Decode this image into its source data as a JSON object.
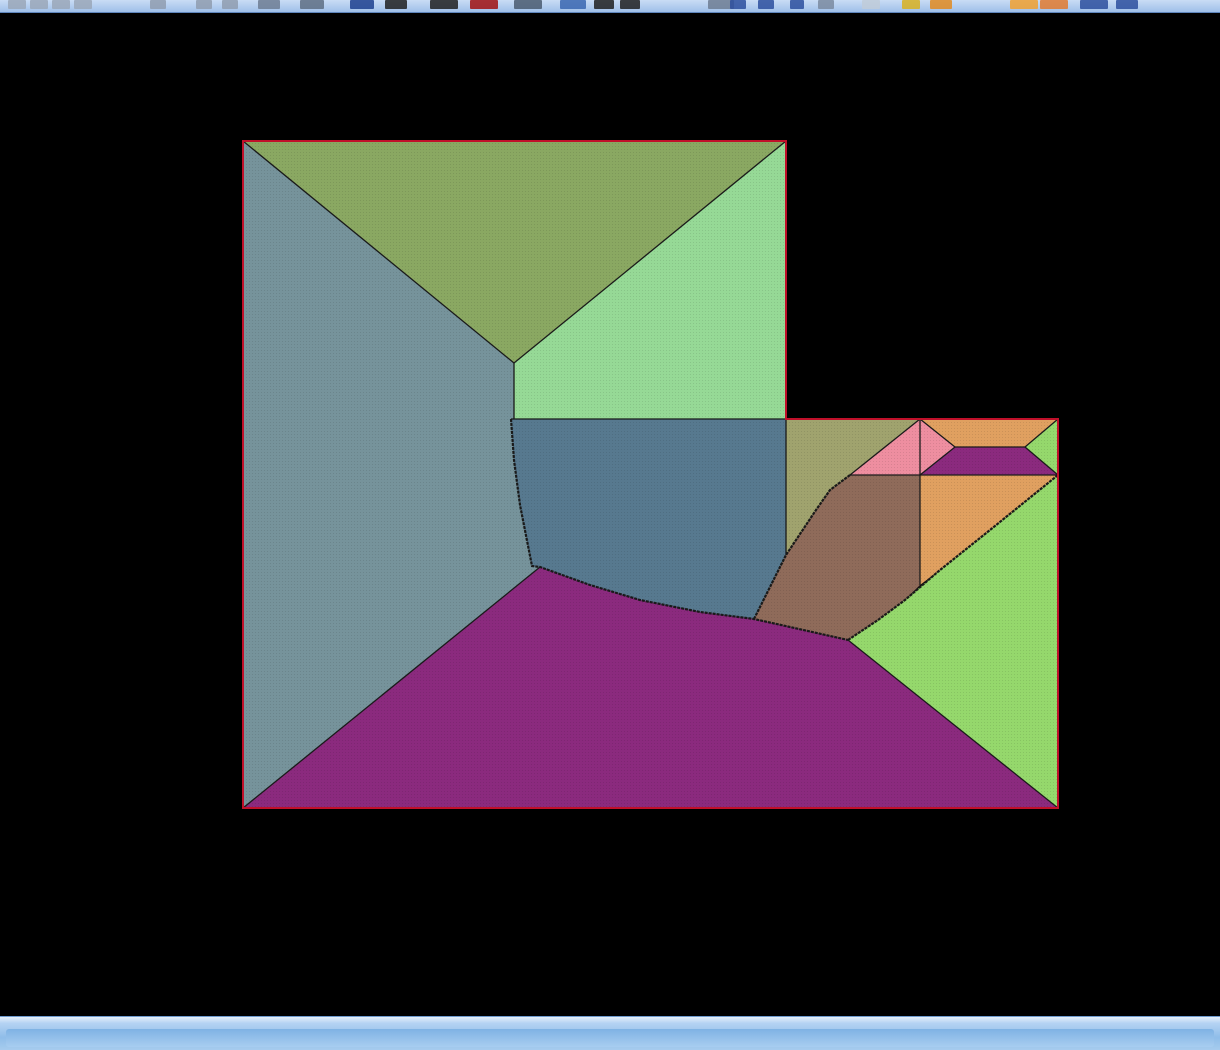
{
  "window": {
    "background": "#000000",
    "toolbar_color": "#a9c6ee",
    "statusbar_color": "#9cc4ee"
  },
  "toolbar": {
    "items": [
      {
        "icon": "pencil-icon",
        "color": "#9aa7b8"
      },
      {
        "icon": "pencil-icon",
        "color": "#9aa7b8"
      },
      {
        "icon": "pencil-icon",
        "color": "#9aa7b8"
      },
      {
        "icon": "pencil-icon",
        "color": "#9aa7b8"
      },
      {
        "icon": "grid-icon",
        "color": "#8f9caf"
      },
      {
        "icon": "grid-icon",
        "color": "#8f9caf"
      },
      {
        "icon": "scissors-icon",
        "color": "#8f9caf"
      },
      {
        "icon": "select-icon",
        "color": "#6d7d93"
      },
      {
        "icon": "rectangle-icon",
        "color": "#5e6e84"
      },
      {
        "icon": "layer-icon",
        "color": "#1d3f8e"
      },
      {
        "icon": "window-icon",
        "color": "#202020"
      },
      {
        "icon": "window-icon",
        "color": "#202020"
      },
      {
        "icon": "color-swatch-icon",
        "color": "#a01010"
      },
      {
        "icon": "line-icon",
        "color": "#4a5a70"
      },
      {
        "icon": "text-icon",
        "color": "#3a66b0"
      },
      {
        "icon": "arrow-up-icon",
        "color": "#202020"
      },
      {
        "icon": "arrow-down-icon",
        "color": "#202020"
      },
      {
        "icon": "bar-icon",
        "color": "#6d7d93"
      },
      {
        "icon": "magnet-icon",
        "color": "#2d4f9e"
      },
      {
        "icon": "link-icon",
        "color": "#2d4f9e"
      },
      {
        "icon": "flag-icon",
        "color": "#2d4f9e"
      },
      {
        "icon": "zoom-icon",
        "color": "#7a8aa0"
      },
      {
        "icon": "rectangle-icon",
        "color": "#c0cbd8"
      },
      {
        "icon": "star-icon",
        "color": "#d8b020"
      },
      {
        "icon": "table-icon",
        "color": "#e08a20"
      },
      {
        "icon": "table-icon",
        "color": "#f0a030"
      },
      {
        "icon": "table-icon",
        "color": "#e07a30"
      },
      {
        "icon": "view-icon",
        "color": "#2d4f9e"
      },
      {
        "icon": "view-icon",
        "color": "#2d4f9e"
      }
    ]
  },
  "drawing": {
    "border_color": "#c0102a",
    "edge_color": "#1a1a1a",
    "regions": [
      {
        "name": "west-hip-face",
        "color": "#76939b"
      },
      {
        "name": "north-hip-face",
        "color": "#8aa862"
      },
      {
        "name": "northeast-face",
        "color": "#96d996"
      },
      {
        "name": "center-blue-face",
        "color": "#57798f"
      },
      {
        "name": "south-purple-face",
        "color": "#8b2a7e"
      },
      {
        "name": "east-green-face",
        "color": "#95d86c"
      },
      {
        "name": "olive-valley-face",
        "color": "#a0a36e"
      },
      {
        "name": "brown-valley-face",
        "color": "#8f6b5a"
      },
      {
        "name": "pink-gable-face",
        "color": "#ee8ea0"
      },
      {
        "name": "orange-top-face",
        "color": "#e0a060"
      },
      {
        "name": "small-purple-face",
        "color": "#8b2a7e"
      },
      {
        "name": "orange-mid-face",
        "color": "#e0a060"
      },
      {
        "name": "small-green-face",
        "color": "#95d86c"
      }
    ]
  }
}
